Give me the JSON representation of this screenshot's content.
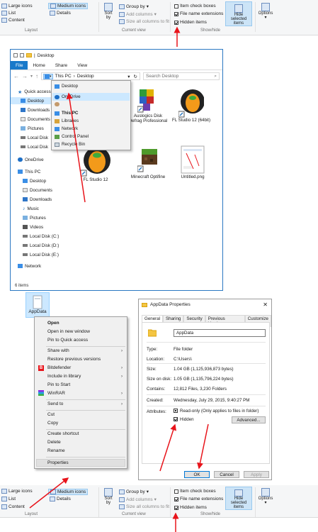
{
  "ribbon_top": {
    "layout_items": [
      "Large icons",
      "List",
      "Content"
    ],
    "layout_items_right": [
      "Medium icons",
      "Details"
    ],
    "layout_label": "Layout",
    "sort_by": "Sort by",
    "group_by": "Group by",
    "add_columns": "Add columns",
    "size_all_columns": "Size all columns to fit",
    "current_view_label": "Current view",
    "item_check_boxes": "Item check boxes",
    "file_name_extensions": "File name extensions",
    "hidden_items": "Hidden items",
    "hide_selected_items": "Hide selected items",
    "show_hide_label": "Show/hide",
    "options": "Options"
  },
  "explorer": {
    "title": "Desktop",
    "tabs": [
      "File",
      "Home",
      "Share",
      "View"
    ],
    "breadcrumb": [
      "This PC",
      "Desktop"
    ],
    "search_placeholder": "Search Desktop",
    "nav": [
      {
        "label": "Quick access",
        "icon": "star-icon"
      },
      {
        "label": "Desktop",
        "icon": "desktop-icon"
      },
      {
        "label": "Downloads",
        "icon": "downloads-icon"
      },
      {
        "label": "Documents",
        "icon": "documents-icon"
      },
      {
        "label": "Pictures",
        "icon": "pictures-icon"
      },
      {
        "label": "Local Disk",
        "icon": "disk-icon"
      },
      {
        "label": "Local Disk",
        "icon": "disk-icon"
      },
      {
        "label": "OneDrive",
        "icon": "onedrive-icon"
      },
      {
        "label": "This PC",
        "icon": "thispc-icon"
      },
      {
        "label": "Desktop",
        "icon": "desktop-icon"
      },
      {
        "label": "Documents",
        "icon": "documents-icon"
      },
      {
        "label": "Downloads",
        "icon": "downloads-icon"
      },
      {
        "label": "Music",
        "icon": "music-icon"
      },
      {
        "label": "Pictures",
        "icon": "pictures-icon"
      },
      {
        "label": "Videos",
        "icon": "videos-icon"
      },
      {
        "label": "Local Disk (C:)",
        "icon": "disk-icon"
      },
      {
        "label": "Local Disk (D:)",
        "icon": "disk-icon"
      },
      {
        "label": "Local Disk (E:)",
        "icon": "disk-icon"
      },
      {
        "label": "Network",
        "icon": "network-icon"
      }
    ],
    "status": "6 items",
    "dropdown": [
      {
        "label": "Desktop",
        "icon": "desktop-icon"
      },
      {
        "label": "OneDrive",
        "icon": "onedrive-icon"
      },
      {
        "label": "",
        "icon": "user-icon"
      },
      {
        "label": "This PC",
        "icon": "thispc-icon"
      },
      {
        "label": "Libraries",
        "icon": "libraries-icon"
      },
      {
        "label": "Network",
        "icon": "network-icon"
      },
      {
        "label": "Control Panel",
        "icon": "control-panel-icon"
      },
      {
        "label": "Recycle Bin",
        "icon": "recycle-bin-icon"
      }
    ],
    "files": [
      {
        "label": "Auslogics Disk Defrag Professional",
        "icon": "defrag-icon"
      },
      {
        "label": "FL Studio 12 (64bit)",
        "icon": "fl-studio-icon"
      },
      {
        "label": "FL Studio 12",
        "icon": "fl-studio-icon"
      },
      {
        "label": "Minecraft Optifine",
        "icon": "minecraft-icon"
      },
      {
        "label": "Untitled.png",
        "icon": "image-file-icon"
      }
    ]
  },
  "folder_icon_label": "AppData",
  "context_menu": {
    "items": [
      "Open",
      "Open in new window",
      "Pin to Quick access",
      "Share with",
      "Restore previous versions",
      "Bitdefender",
      "Include in library",
      "Pin to Start",
      "WinRAR",
      "Send to",
      "Cut",
      "Copy",
      "Create shortcut",
      "Delete",
      "Rename",
      "Properties"
    ]
  },
  "properties": {
    "title": "AppData Properties",
    "tabs": [
      "General",
      "Sharing",
      "Security",
      "Previous Versions",
      "Customize"
    ],
    "name": "AppData",
    "rows": [
      {
        "label": "Type:",
        "value": "File folder"
      },
      {
        "label": "Location:",
        "value": "C:\\Users\\"
      },
      {
        "label": "Size:",
        "value": "1.04 GB (1,125,936,873 bytes)"
      },
      {
        "label": "Size on disk:",
        "value": "1.05 GB (1,135,796,224 bytes)"
      },
      {
        "label": "Contains:",
        "value": "12,812 Files, 3,230 Folders"
      },
      {
        "label": "Created:",
        "value": "Wednesday, July 29, 2015, 9:40:27 PM"
      }
    ],
    "attributes_label": "Attributes:",
    "read_only": "Read-only (Only applies to files in folder)",
    "hidden": "Hidden",
    "advanced": "Advanced...",
    "ok": "OK",
    "cancel": "Cancel",
    "apply": "Apply"
  },
  "ribbon_bottom": {
    "layout_items": [
      "Large icons",
      "List",
      "Content"
    ],
    "layout_items_right": [
      "Medium icons",
      "Details"
    ],
    "layout_label": "Layout",
    "sort_by": "Sort by",
    "group_by": "Group by",
    "add_columns": "Add columns",
    "size_all_columns": "Size all columns to fit",
    "current_view_label": "Current view",
    "item_check_boxes": "Item check boxes",
    "file_name_extensions": "File name extensions",
    "hidden_items": "Hidden items",
    "hide_selected_items": "Hide selected items",
    "show_hide_label": "Show/hide",
    "options": "Options"
  },
  "colors": {
    "accent": "#1979ca",
    "annotation": "#e8141b",
    "selection": "#cce8ff"
  }
}
